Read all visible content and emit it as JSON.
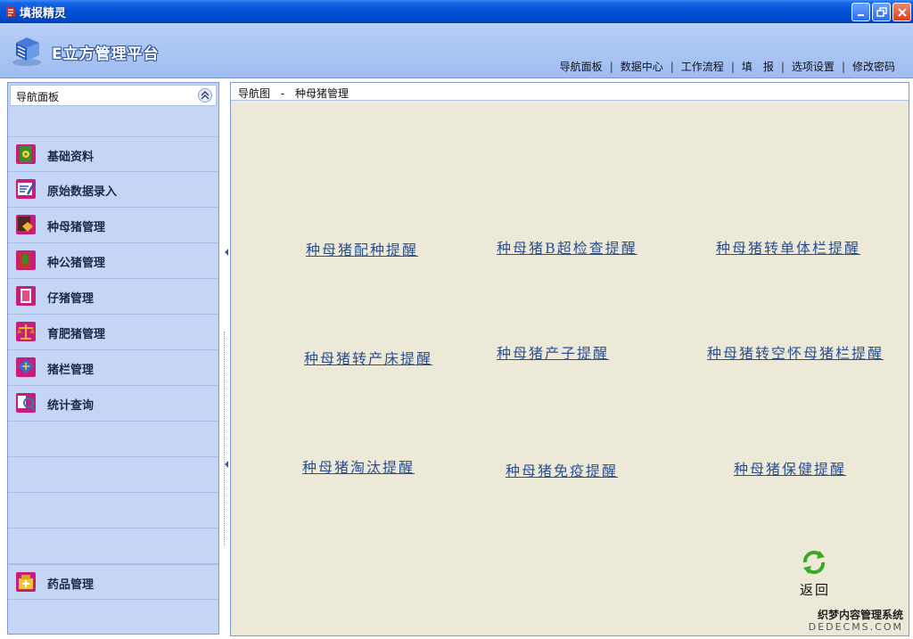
{
  "window": {
    "title": "填报精灵"
  },
  "header": {
    "brand": "E立方管理平台",
    "nav": [
      "导航面板",
      "数据中心",
      "工作流程",
      "填　报",
      "选项设置",
      "修改密码"
    ]
  },
  "left_panel": {
    "title": "导航面板",
    "items": [
      {
        "label": "基础资料",
        "icon": "book-gear-icon",
        "color": "#3b8c2a"
      },
      {
        "label": "原始数据录入",
        "icon": "form-pen-icon",
        "color": "#2a5ab8"
      },
      {
        "label": "种母猪管理",
        "icon": "sow-icon",
        "color": "#d69a1e"
      },
      {
        "label": "种公猪管理",
        "icon": "boar-icon",
        "color": "#b83a2a"
      },
      {
        "label": "仔猪管理",
        "icon": "piglet-icon",
        "color": "#c03a7a"
      },
      {
        "label": "育肥猪管理",
        "icon": "scale-icon",
        "color": "#c0801a"
      },
      {
        "label": "猪栏管理",
        "icon": "pen-house-icon",
        "color": "#3a6ad0"
      },
      {
        "label": "统计查询",
        "icon": "search-chart-icon",
        "color": "#2a7ab8"
      }
    ],
    "bottom_item": {
      "label": "药品管理",
      "icon": "medicine-box-icon",
      "color": "#d6a81e"
    }
  },
  "right_panel": {
    "breadcrumb_root": "导航图",
    "breadcrumb_current": "种母猪管理",
    "links": [
      "种母猪配种提醒",
      "种母猪B超检查提醒",
      "种母猪转单体栏提醒",
      "种母猪转产床提醒",
      "种母猪产子提醒",
      "种母猪转空怀母猪栏提醒",
      "种母猪淘汰提醒",
      "种母猪免疫提醒",
      "种母猪保健提醒"
    ],
    "back_label": "返回"
  },
  "watermark": {
    "line1": "织梦内容管理系统",
    "line2": "DEDECMS.COM"
  },
  "colors": {
    "titlebar": "#0052d6",
    "link": "#2b4f8f",
    "panel_bg": "#c5d5f5",
    "content_bg": "#ece9d8"
  }
}
